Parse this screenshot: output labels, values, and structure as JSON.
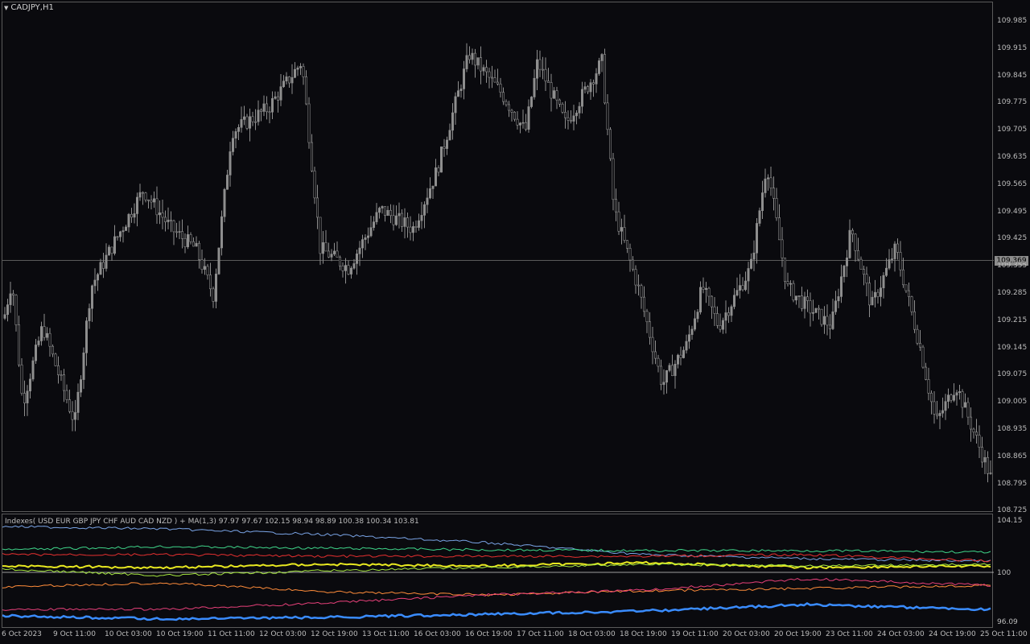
{
  "chart": {
    "symbol_title": "CADJPY,H1",
    "indicator_title": "Indexes( USD EUR GBP JPY CHF AUD CAD NZD ) + MA(1,3) 97.97 97.67 102.15 98.94 98.89 100.38 100.34 103.81",
    "current_price": "109.369",
    "price_axis": [
      "109.985",
      "109.915",
      "109.845",
      "109.775",
      "109.705",
      "109.635",
      "109.565",
      "109.495",
      "109.425",
      "109.355",
      "109.285",
      "109.215",
      "109.145",
      "109.075",
      "109.005",
      "108.935",
      "108.865",
      "108.795",
      "108.725"
    ],
    "indicator_axis": [
      "104.15",
      "100",
      "96.09"
    ],
    "time_axis": [
      "6 Oct 2023",
      "9 Oct 11:00",
      "10 Oct 03:00",
      "10 Oct 19:00",
      "11 Oct 11:00",
      "12 Oct 03:00",
      "12 Oct 19:00",
      "13 Oct 11:00",
      "16 Oct 03:00",
      "16 Oct 19:00",
      "17 Oct 11:00",
      "18 Oct 03:00",
      "18 Oct 19:00",
      "19 Oct 11:00",
      "20 Oct 03:00",
      "20 Oct 19:00",
      "23 Oct 11:00",
      "24 Oct 03:00",
      "24 Oct 19:00",
      "25 Oct 11:00"
    ],
    "colors": {
      "background": "#0a0a0e",
      "candle": "#8e8e8e",
      "grid_line": "#5a5a5a",
      "usd": "#7aa4e6",
      "eur": "#3fd68a",
      "gbp": "#e83030",
      "jpy": "#e8e820",
      "chf": "#a7e840",
      "aud": "#ff8c3a",
      "cad": "#e8407a",
      "nzd": "#3a8cff"
    }
  }
}
